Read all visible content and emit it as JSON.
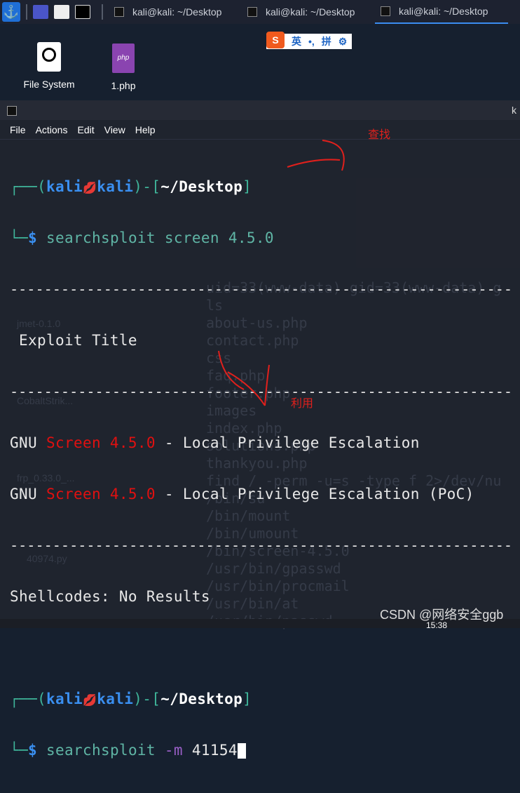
{
  "taskbar": {
    "tasks": [
      {
        "label": "kali@kali: ~/Desktop"
      },
      {
        "label": "kali@kali: ~/Desktop"
      },
      {
        "label": "kali@kali: ~/Desktop",
        "active": true
      }
    ],
    "accent": "#3b8cf0"
  },
  "desktop": {
    "icons": [
      {
        "label": "File System"
      },
      {
        "label": "1.php"
      }
    ],
    "faded_icons": [
      "jmet-0.1.0",
      "CobaltStrik...",
      "frp_0.33.0_...",
      "40974.py"
    ]
  },
  "ime": {
    "logo": "S",
    "mode": "英",
    "punct": "•,",
    "input": "拼"
  },
  "terminal": {
    "title": "k",
    "menu": [
      "File",
      "Actions",
      "Edit",
      "View",
      "Help"
    ],
    "prompt": {
      "open": "┌──(",
      "user": "kali",
      "skull": "💋",
      "host": "kali",
      "mid": ")-[",
      "dir": "~/Desktop",
      "close": "]",
      "line2": "└─",
      "dollar": "$"
    },
    "cmd1": "searchsploit screen 4.5.0",
    "dashes": "-----------------------------------------------------------",
    "header": " Exploit Title",
    "results": [
      {
        "pre": "GNU ",
        "hl": "Screen 4.5.0",
        "post": " - Local Privilege Escalation"
      },
      {
        "pre": "GNU ",
        "hl": "Screen 4.5.0",
        "post": " - Local Privilege Escalation (PoC)"
      }
    ],
    "shellcodes": "Shellcodes: No Results",
    "cmd2": {
      "name": "searchsploit",
      "flag": "-m",
      "arg": "41154"
    },
    "ghost_lines": [
      "uid=33(www-data) gid=33(www-data) g",
      "ls",
      "about-us.php",
      "contact.php",
      "css",
      "faq.php",
      "footer.php",
      "images",
      "index.php",
      "solutions.php",
      "thankyou.php",
      "find / -perm -u=s -type f 2>/dev/nu",
      "/bin/su",
      "/bin/mount",
      "/bin/umount",
      "/bin/screen-4.5.0",
      "/usr/bin/gpasswd",
      "/usr/bin/procmail",
      "/usr/bin/at",
      "/usr/bin/passwd"
    ]
  },
  "annotations": {
    "find": "查找",
    "use": "利用"
  },
  "watermark": "CSDN @网络安全ggb",
  "clock": "15:38"
}
